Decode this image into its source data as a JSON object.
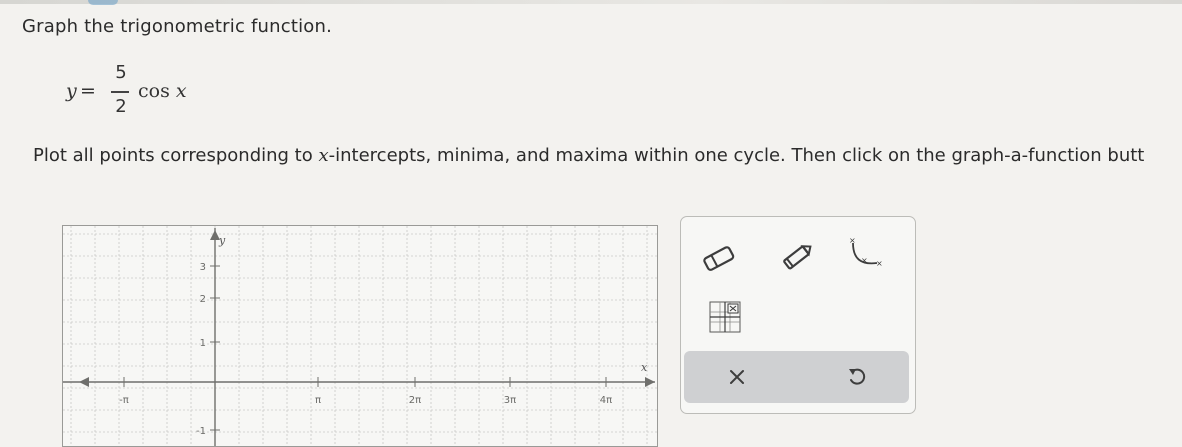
{
  "instruction": "Graph the trigonometric function.",
  "equation": {
    "lhs": "y",
    "equals": "=",
    "numerator": "5",
    "denominator": "2",
    "func": "cos",
    "var": "x"
  },
  "plot_instruction": {
    "before": "Plot all points corresponding to ",
    "var": "x",
    "after": "-intercepts, minima, and maxima within one cycle. Then click on the graph-a-function butt"
  },
  "graph": {
    "x_axis_label": "x",
    "y_axis_label": "y",
    "x_tick_labels": [
      "-π",
      "π",
      "2π",
      "3π",
      "4π"
    ],
    "y_tick_labels": [
      "3",
      "2",
      "1",
      "-1"
    ],
    "grid_color": "#c9c9c6",
    "axis_color": "#6f6f6c"
  },
  "tools": {
    "eraser": "eraser-tool",
    "pencil": "pencil-tool",
    "function": "graph-a-function-tool",
    "grid": "grid-tool",
    "clear": "clear-tool",
    "undo": "undo-tool"
  }
}
